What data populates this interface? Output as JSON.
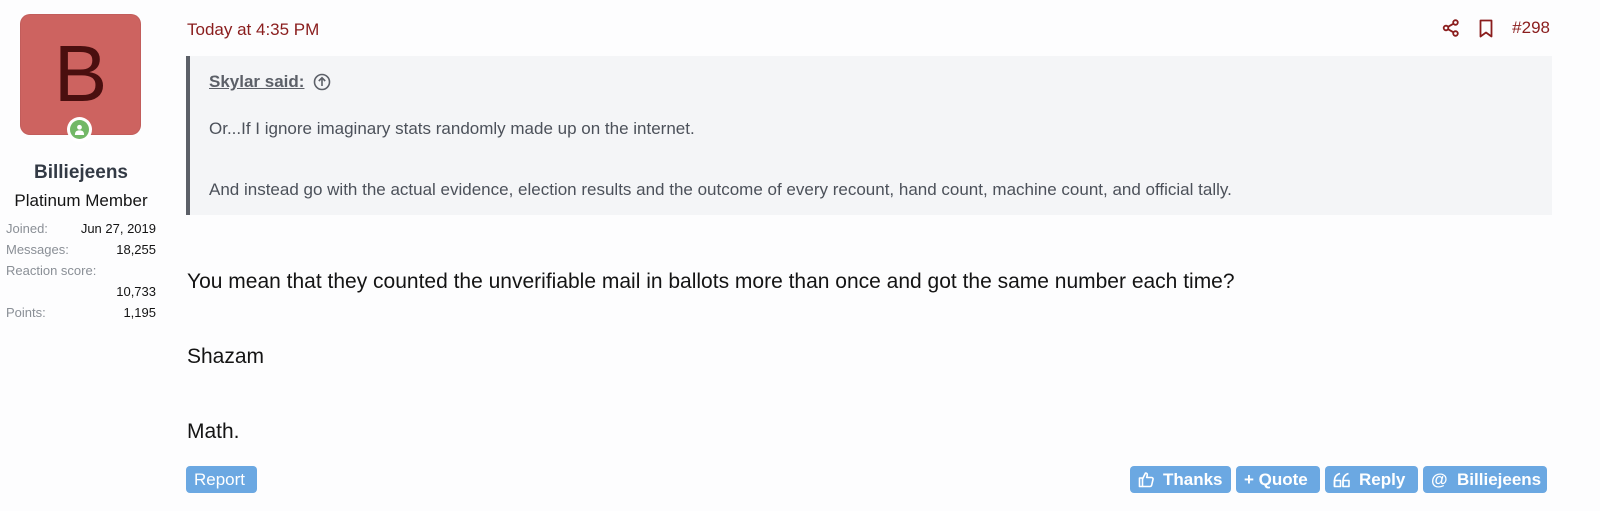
{
  "user": {
    "avatar_letter": "B",
    "avatar_color": "#cd6360",
    "online_color": "#72b866",
    "username": "Billiejeens",
    "title": "Platinum Member",
    "stats": {
      "joined_label": "Joined:",
      "joined_value": "Jun 27, 2019",
      "messages_label": "Messages:",
      "messages_value": "18,255",
      "reaction_label": "Reaction score:",
      "reaction_value": "10,733",
      "points_label": "Points:",
      "points_value": "1,195"
    }
  },
  "post": {
    "date": "Today at 4:35 PM",
    "number": "#298",
    "share_icon": "share-icon",
    "bookmark_icon": "bookmark-icon",
    "quote": {
      "author": "Skylar said:",
      "lines": [
        "Or...If I ignore imaginary stats randomly made up on the internet.",
        "And instead go with the actual evidence, election results and the outcome of every recount, hand count, machine count, and official tally."
      ]
    },
    "body": [
      "You mean that they counted the unverifiable mail in ballots more than once and got the same number each time?",
      "Shazam",
      "Math."
    ]
  },
  "footer": {
    "report": "Report",
    "thanks": "Thanks",
    "quote": "+ Quote",
    "reply": "Reply",
    "mention": "@  Billiejeens",
    "button_color": "#6ba8e2"
  },
  "colors": {
    "accent_red": "#8a1d1d",
    "quote_border": "#5c6068"
  }
}
